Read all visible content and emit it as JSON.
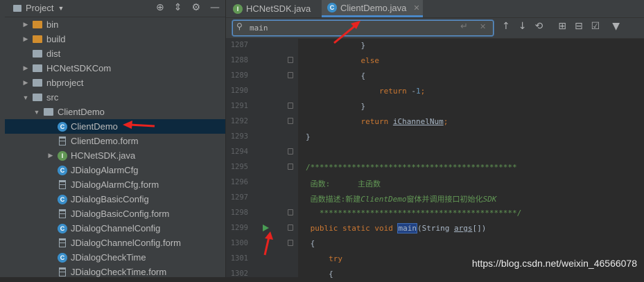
{
  "project": {
    "title": "Project",
    "tree": [
      {
        "label": "bin",
        "type": "folder",
        "color": "orange",
        "depth": 1,
        "arrow": "▶"
      },
      {
        "label": "build",
        "type": "folder",
        "color": "orange",
        "depth": 1,
        "arrow": "▶"
      },
      {
        "label": "dist",
        "type": "folder",
        "color": "gray",
        "depth": 1,
        "arrow": ""
      },
      {
        "label": "HCNetSDKCom",
        "type": "folder",
        "color": "gray",
        "depth": 1,
        "arrow": "▶"
      },
      {
        "label": "nbproject",
        "type": "folder",
        "color": "gray",
        "depth": 1,
        "arrow": "▶"
      },
      {
        "label": "src",
        "type": "folder",
        "color": "blue",
        "depth": 1,
        "arrow": "▼"
      },
      {
        "label": "ClientDemo",
        "type": "folder",
        "color": "gray",
        "depth": 2,
        "arrow": "▼"
      },
      {
        "label": "ClientDemo",
        "type": "class-main",
        "depth": 3,
        "arrow": "",
        "selected": true
      },
      {
        "label": "ClientDemo.form",
        "type": "form",
        "depth": 3,
        "arrow": ""
      },
      {
        "label": "HCNetSDK.java",
        "type": "interface",
        "depth": 3,
        "arrow": "▶"
      },
      {
        "label": "JDialogAlarmCfg",
        "type": "class",
        "depth": 3,
        "arrow": ""
      },
      {
        "label": "JDialogAlarmCfg.form",
        "type": "form",
        "depth": 3,
        "arrow": ""
      },
      {
        "label": "JDialogBasicConfig",
        "type": "class",
        "depth": 3,
        "arrow": ""
      },
      {
        "label": "JDialogBasicConfig.form",
        "type": "form",
        "depth": 3,
        "arrow": ""
      },
      {
        "label": "JDialogChannelConfig",
        "type": "class",
        "depth": 3,
        "arrow": ""
      },
      {
        "label": "JDialogChannelConfig.form",
        "type": "form",
        "depth": 3,
        "arrow": ""
      },
      {
        "label": "JDialogCheckTime",
        "type": "class",
        "depth": 3,
        "arrow": ""
      },
      {
        "label": "JDialogCheckTime.form",
        "type": "form",
        "depth": 3,
        "arrow": ""
      }
    ]
  },
  "tabs": [
    {
      "label": "HCNetSDK.java",
      "active": false
    },
    {
      "label": "ClientDemo.java",
      "active": true
    }
  ],
  "search": {
    "value": "main"
  },
  "code_lines": [
    {
      "n": "1287",
      "html": "            }"
    },
    {
      "n": "1288",
      "html": "            <span class='kw'>else</span>"
    },
    {
      "n": "1289",
      "html": "            {"
    },
    {
      "n": "1290",
      "html": "                <span class='kw'>return</span> -<span class='num'>1</span><span class='kw'>;</span>"
    },
    {
      "n": "1291",
      "html": "            }"
    },
    {
      "n": "1292",
      "html": "            <span class='kw'>return</span> <span class='und'>iChannelNum</span><span class='kw'>;</span>"
    },
    {
      "n": "1293",
      "html": "}"
    },
    {
      "n": "1294",
      "html": ""
    },
    {
      "n": "1295",
      "html": "<span class='cm'>/*********************************************</span>"
    },
    {
      "n": "1296",
      "html": "<span class='cm'> 函数:      主函数</span>"
    },
    {
      "n": "1297",
      "html": "<span class='cm'> 函数描述:新建</span><span class='cmi'>ClientDemo</span><span class='cm'>窗体并调用接口初始化</span><span class='cmi'>SDK</span>"
    },
    {
      "n": "1298",
      "html": "<span class='cm'>   *******************************************/</span>"
    },
    {
      "n": "1299",
      "html": " <span class='kw'>public static void</span> <span class='fn-hl'>main</span>(String <span class='und'>args</span>[])",
      "run": true
    },
    {
      "n": "1300",
      "html": " {"
    },
    {
      "n": "1301",
      "html": "     <span class='kw'>try</span>"
    },
    {
      "n": "1302",
      "html": "     {"
    }
  ],
  "watermark": "https://blog.csdn.net/weixin_46566078"
}
